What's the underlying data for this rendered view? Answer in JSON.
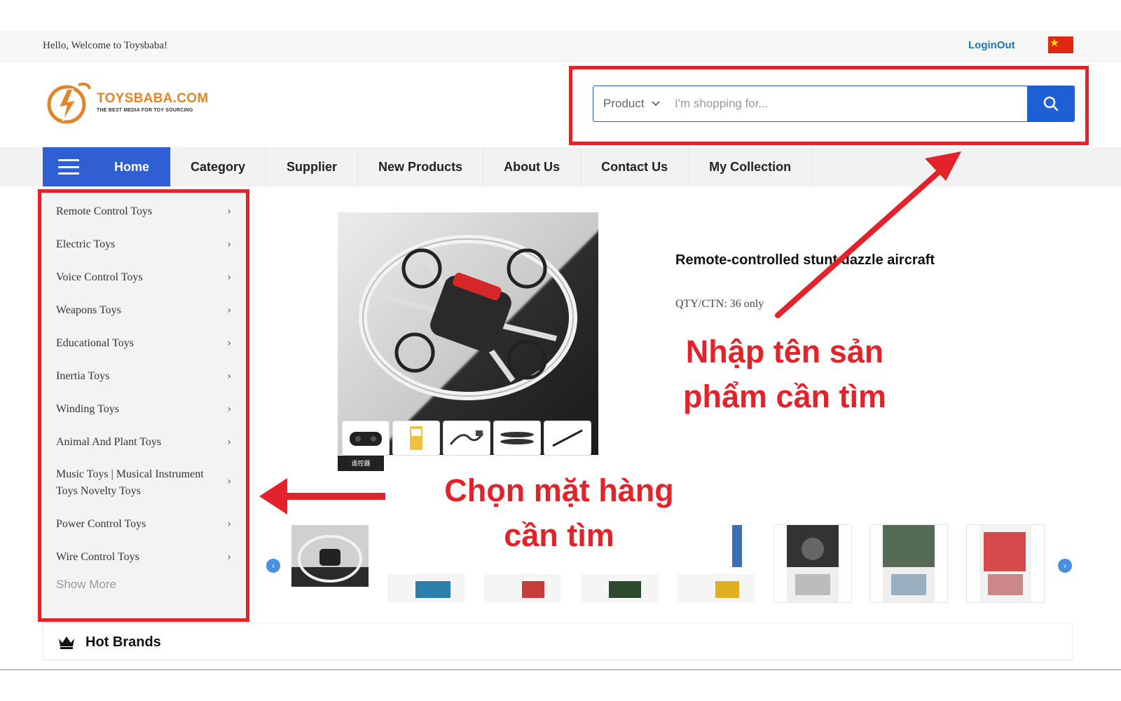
{
  "topbar": {
    "welcome": "Hello, Welcome to Toysbaba!",
    "login": "LoginOut",
    "flag_icon": "china-flag-icon",
    "flag_color": "#de2910"
  },
  "logo": {
    "name": "TOYSBABA.COM",
    "tagline": "THE BEST MEDIA FOR TOY SOURCING"
  },
  "search": {
    "type_label": "Product",
    "placeholder": "I'm shopping for...",
    "button_icon": "search-icon",
    "accent": "#1e5fd4"
  },
  "nav": {
    "home": "Home",
    "items": [
      "Category",
      "Supplier",
      "New Products",
      "About Us",
      "Contact Us",
      "My Collection"
    ],
    "accent": "#2f5fd3"
  },
  "sidebar": {
    "items": [
      {
        "label": "Remote Control Toys"
      },
      {
        "label": "Electric Toys"
      },
      {
        "label": "Voice Control Toys"
      },
      {
        "label": "Weapons Toys"
      },
      {
        "label": "Educational Toys"
      },
      {
        "label": "Inertia Toys"
      },
      {
        "label": "Winding Toys"
      },
      {
        "label": "Animal And Plant Toys"
      },
      {
        "label": "Music Toys | Musical Instrument Toys Novelty Toys"
      },
      {
        "label": "Power Control Toys"
      },
      {
        "label": "Wire Control Toys"
      }
    ],
    "show_more": "Show More"
  },
  "product": {
    "title": "Remote-controlled stunt dazzle aircraft",
    "qty": "QTY/CTN: 36 only",
    "image_tag": "遥控器"
  },
  "hot_brands": {
    "title": "Hot Brands",
    "icon": "crown-icon"
  },
  "annotations": {
    "search_hint": "Nhập tên sản phẩm cần tìm",
    "category_hint": "Chọn mặt hàng cần tìm",
    "color": "#e42229"
  }
}
